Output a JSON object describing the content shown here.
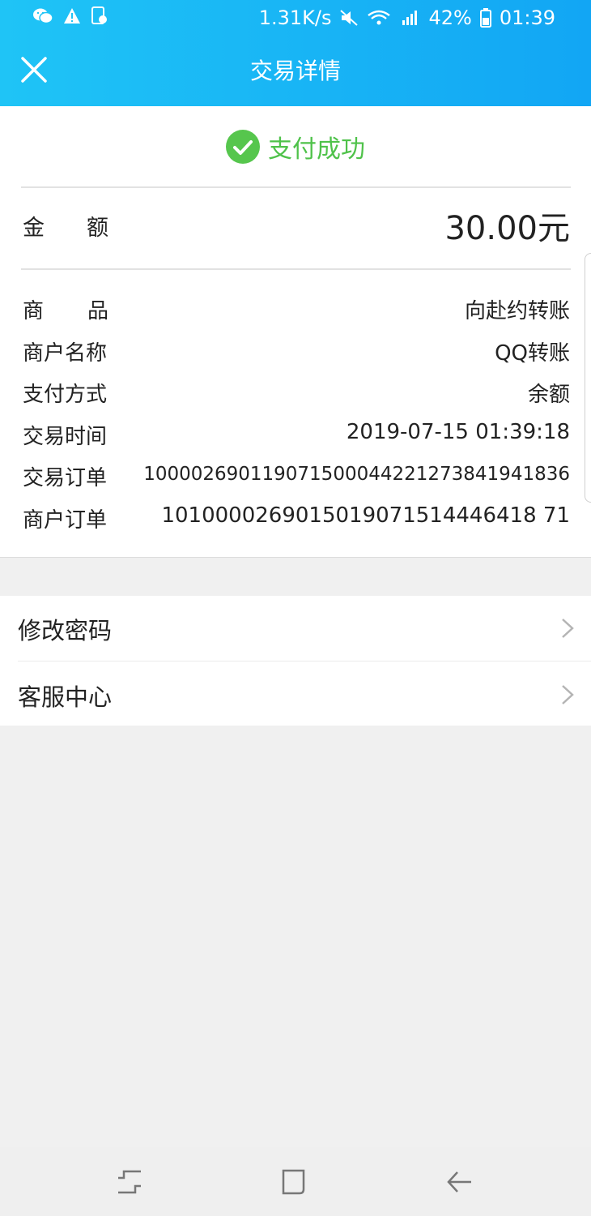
{
  "status_bar": {
    "network_speed": "1.31K/s",
    "battery": "42%",
    "time": "01:39",
    "icons": [
      "wechat-icon",
      "warning-icon",
      "file-icon",
      "mute-icon",
      "wifi-icon",
      "signal-icon",
      "battery-icon"
    ]
  },
  "header": {
    "title": "交易详情",
    "close_icon": "close-icon"
  },
  "status": {
    "icon": "check-circle-icon",
    "text": "支付成功",
    "color": "#4fc24a"
  },
  "amount": {
    "label_chars": [
      "金",
      "额"
    ],
    "value": "30.00元"
  },
  "details": [
    {
      "label_chars": [
        "商",
        "品"
      ],
      "value": "向赴约转账"
    },
    {
      "label": "商户名称",
      "value": "QQ转账"
    },
    {
      "label": "支付方式",
      "value": "余额"
    },
    {
      "label": "交易时间",
      "value": "2019-07-15 01:39:18"
    },
    {
      "label": "交易订单",
      "value": "100002690119071500044221273841941836"
    },
    {
      "label": "商户订单",
      "value": "1010000269015019071514446418 71"
    }
  ],
  "menu": [
    {
      "label": "修改密码",
      "icon": "chevron-right-icon"
    },
    {
      "label": "客服中心",
      "icon": "chevron-right-icon"
    }
  ],
  "colors": {
    "header_start": "#1fc4f6",
    "header_end": "#12a6f4",
    "background": "#f0f0f0"
  }
}
